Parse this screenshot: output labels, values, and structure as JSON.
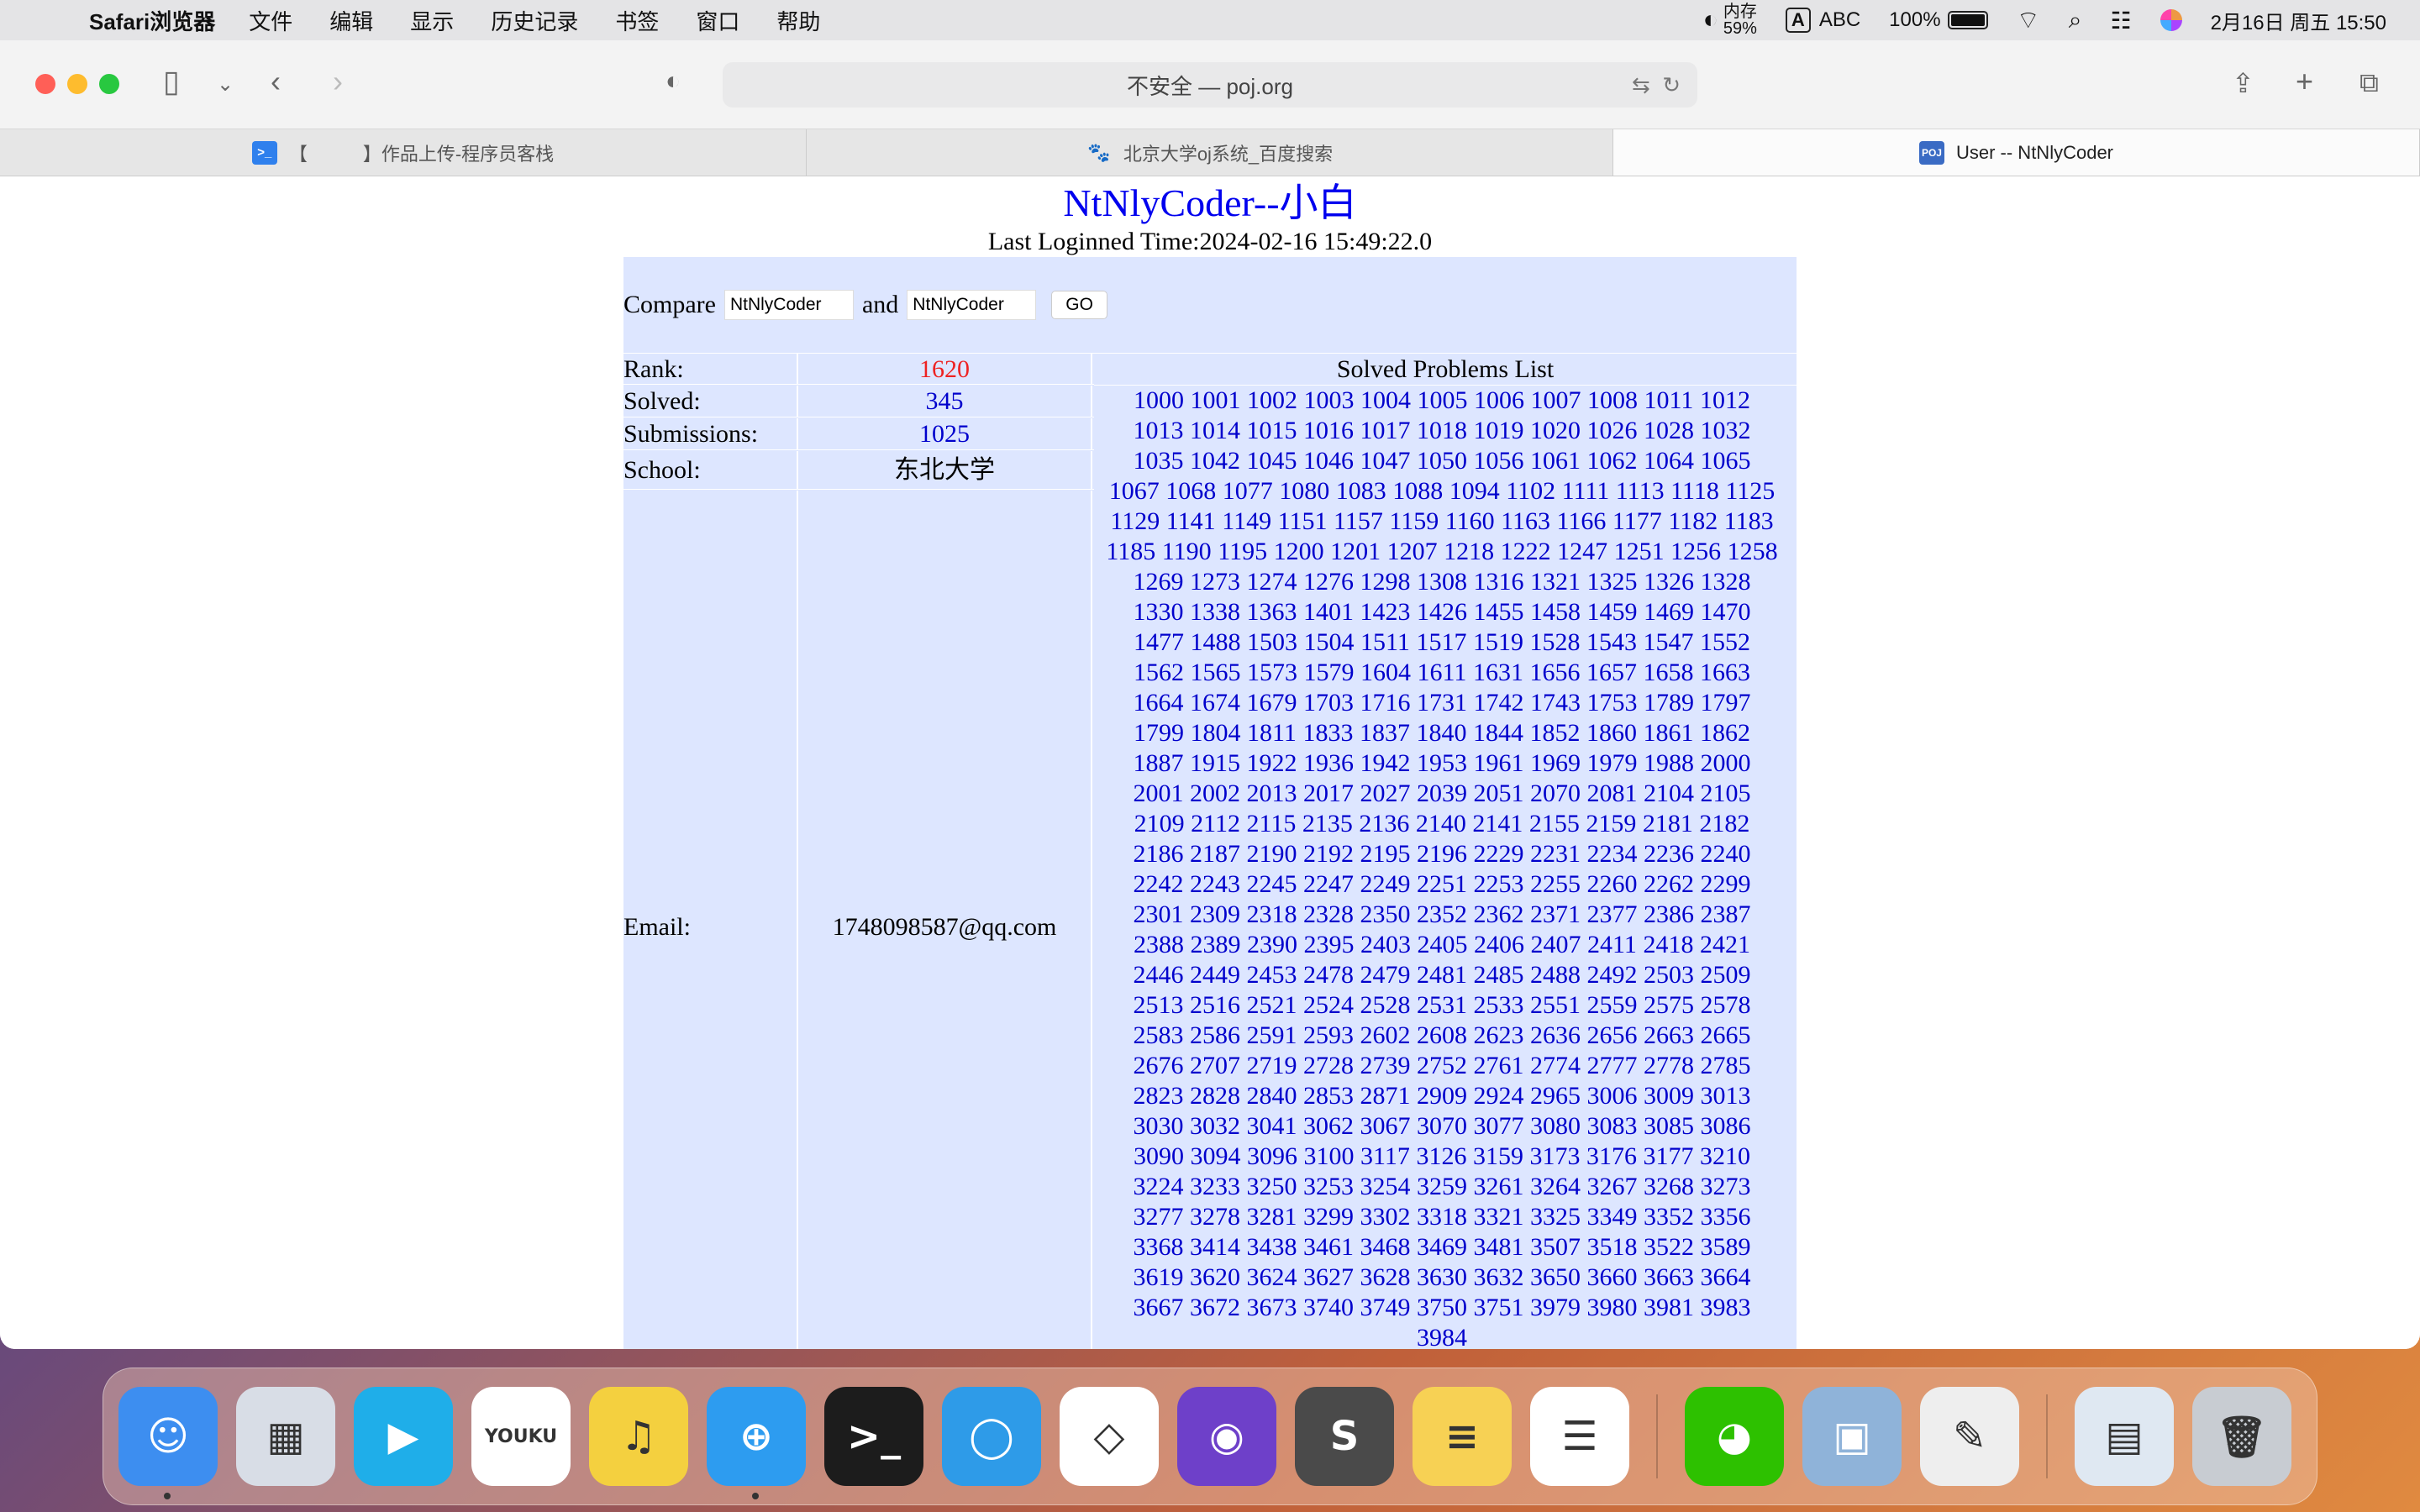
{
  "menubar": {
    "app_name": "Safari浏览器",
    "items": [
      "文件",
      "编辑",
      "显示",
      "历史记录",
      "书签",
      "窗口",
      "帮助"
    ],
    "status": {
      "vpn_label": "内存",
      "vpn_value": "59%",
      "input_badge": "A",
      "input_method": "ABC",
      "battery": "100%",
      "battery_level": 1.0,
      "datetime": "2月16日 周五  15:50"
    }
  },
  "browser": {
    "address": "不安全 — poj.org",
    "tabs": [
      {
        "title": "【　　　】作品上传-程序员客栈",
        "favicon_label": ">_",
        "favicon_color": "#2f80ed",
        "active": false
      },
      {
        "title": "北京大学oj系统_百度搜索",
        "favicon_label": "🐾",
        "favicon_color": "#2932e1",
        "active": false
      },
      {
        "title": "User -- NtNlyCoder",
        "favicon_label": "POJ",
        "favicon_color": "#3a6bc4",
        "active": true
      }
    ]
  },
  "page": {
    "title": "NtNlyCoder--小白",
    "last_login": "Last Loginned Time:2024-02-16 15:49:22.0",
    "compare": {
      "label": "Compare",
      "and_label": "and",
      "user1": "NtNlyCoder",
      "user2": "NtNlyCoder",
      "go_label": "GO"
    },
    "stats": {
      "rank_label": "Rank:",
      "rank_value": "1620",
      "solved_label": "Solved:",
      "solved_value": "345",
      "submissions_label": "Submissions:",
      "submissions_value": "1025",
      "school_label": "School:",
      "school_value": "东北大学",
      "email_label": "Email:",
      "email_value": "1748098587@qq.com"
    },
    "solved_header": "Solved Problems List",
    "solved_problems": [
      "1000",
      "1001",
      "1002",
      "1003",
      "1004",
      "1005",
      "1006",
      "1007",
      "1008",
      "1011",
      "1012",
      "1013",
      "1014",
      "1015",
      "1016",
      "1017",
      "1018",
      "1019",
      "1020",
      "1026",
      "1028",
      "1032",
      "1035",
      "1042",
      "1045",
      "1046",
      "1047",
      "1050",
      "1056",
      "1061",
      "1062",
      "1064",
      "1065",
      "1067",
      "1068",
      "1077",
      "1080",
      "1083",
      "1088",
      "1094",
      "1102",
      "1111",
      "1113",
      "1118",
      "1125",
      "1129",
      "1141",
      "1149",
      "1151",
      "1157",
      "1159",
      "1160",
      "1163",
      "1166",
      "1177",
      "1182",
      "1183",
      "1185",
      "1190",
      "1195",
      "1200",
      "1201",
      "1207",
      "1218",
      "1222",
      "1247",
      "1251",
      "1256",
      "1258",
      "1269",
      "1273",
      "1274",
      "1276",
      "1298",
      "1308",
      "1316",
      "1321",
      "1325",
      "1326",
      "1328",
      "1330",
      "1338",
      "1363",
      "1401",
      "1423",
      "1426",
      "1455",
      "1458",
      "1459",
      "1469",
      "1470",
      "1477",
      "1488",
      "1503",
      "1504",
      "1511",
      "1517",
      "1519",
      "1528",
      "1543",
      "1547",
      "1552",
      "1562",
      "1565",
      "1573",
      "1579",
      "1604",
      "1611",
      "1631",
      "1656",
      "1657",
      "1658",
      "1663",
      "1664",
      "1674",
      "1679",
      "1703",
      "1716",
      "1731",
      "1742",
      "1743",
      "1753",
      "1789",
      "1797",
      "1799",
      "1804",
      "1811",
      "1833",
      "1837",
      "1840",
      "1844",
      "1852",
      "1860",
      "1861",
      "1862",
      "1887",
      "1915",
      "1922",
      "1936",
      "1942",
      "1953",
      "1961",
      "1969",
      "1979",
      "1988",
      "2000",
      "2001",
      "2002",
      "2013",
      "2017",
      "2027",
      "2039",
      "2051",
      "2070",
      "2081",
      "2104",
      "2105",
      "2109",
      "2112",
      "2115",
      "2135",
      "2136",
      "2140",
      "2141",
      "2155",
      "2159",
      "2181",
      "2182",
      "2186",
      "2187",
      "2190",
      "2192",
      "2195",
      "2196",
      "2229",
      "2231",
      "2234",
      "2236",
      "2240",
      "2242",
      "2243",
      "2245",
      "2247",
      "2249",
      "2251",
      "2253",
      "2255",
      "2260",
      "2262",
      "2299",
      "2301",
      "2309",
      "2318",
      "2328",
      "2350",
      "2352",
      "2362",
      "2371",
      "2377",
      "2386",
      "2387",
      "2388",
      "2389",
      "2390",
      "2395",
      "2403",
      "2405",
      "2406",
      "2407",
      "2411",
      "2418",
      "2421",
      "2446",
      "2449",
      "2453",
      "2478",
      "2479",
      "2481",
      "2485",
      "2488",
      "2492",
      "2503",
      "2509",
      "2513",
      "2516",
      "2521",
      "2524",
      "2528",
      "2531",
      "2533",
      "2551",
      "2559",
      "2575",
      "2578",
      "2583",
      "2586",
      "2591",
      "2593",
      "2602",
      "2608",
      "2623",
      "2636",
      "2656",
      "2663",
      "2665",
      "2676",
      "2707",
      "2719",
      "2728",
      "2739",
      "2752",
      "2761",
      "2774",
      "2777",
      "2778",
      "2785",
      "2823",
      "2828",
      "2840",
      "2853",
      "2871",
      "2909",
      "2924",
      "2965",
      "3006",
      "3009",
      "3013",
      "3030",
      "3032",
      "3041",
      "3062",
      "3067",
      "3070",
      "3077",
      "3080",
      "3083",
      "3085",
      "3086",
      "3090",
      "3094",
      "3096",
      "3100",
      "3117",
      "3126",
      "3159",
      "3173",
      "3176",
      "3177",
      "3210",
      "3224",
      "3233",
      "3250",
      "3253",
      "3254",
      "3259",
      "3261",
      "3264",
      "3267",
      "3268",
      "3273",
      "3277",
      "3278",
      "3281",
      "3299",
      "3302",
      "3318",
      "3321",
      "3325",
      "3349",
      "3352",
      "3356",
      "3368",
      "3414",
      "3438",
      "3461",
      "3468",
      "3469",
      "3481",
      "3507",
      "3518",
      "3522",
      "3589",
      "3619",
      "3620",
      "3624",
      "3627",
      "3628",
      "3630",
      "3632",
      "3650",
      "3660",
      "3663",
      "3664",
      "3667",
      "3672",
      "3673",
      "3740",
      "3749",
      "3750",
      "3751",
      "3979",
      "3980",
      "3981",
      "3983",
      "3984"
    ]
  },
  "dock": {
    "apps": [
      {
        "name": "finder-icon",
        "label": "☺",
        "color": "#3d8ef0",
        "running": true
      },
      {
        "name": "launchpad-icon",
        "label": "▦",
        "color": "#d8dde6",
        "running": false
      },
      {
        "name": "tencent-video-icon",
        "label": "▶",
        "color": "#1faee9",
        "running": false
      },
      {
        "name": "youku-icon",
        "label": "YOUKU",
        "color": "#ffffff",
        "running": false
      },
      {
        "name": "qq-music-icon",
        "label": "♫",
        "color": "#f4d03f",
        "running": false
      },
      {
        "name": "safari-icon",
        "label": "⊕",
        "color": "#2d9cf0",
        "running": true
      },
      {
        "name": "terminal-icon",
        "label": ">_",
        "color": "#1c1c1c",
        "running": false
      },
      {
        "name": "chat-app-icon",
        "label": "◯",
        "color": "#2e9be8",
        "running": false
      },
      {
        "name": "unity-icon",
        "label": "◇",
        "color": "#ffffff",
        "running": false
      },
      {
        "name": "github-desktop-icon",
        "label": "◉",
        "color": "#6e40c9",
        "running": false
      },
      {
        "name": "sublime-text-icon",
        "label": "S",
        "color": "#4a4a4a",
        "running": false
      },
      {
        "name": "notes-icon",
        "label": "≡",
        "color": "#f7d154",
        "running": false
      },
      {
        "name": "reminders-icon",
        "label": "☰",
        "color": "#ffffff",
        "running": false
      },
      {
        "name": "wechat-icon",
        "label": "◕",
        "color": "#2dc100",
        "running": false
      },
      {
        "name": "preview-icon",
        "label": "▣",
        "color": "#8fb3d9",
        "running": false
      },
      {
        "name": "textedit-icon",
        "label": "✎",
        "color": "#eeeeee",
        "running": false
      },
      {
        "name": "downloads-stack-icon",
        "label": "▤",
        "color": "#dfe8f2",
        "running": false
      },
      {
        "name": "trash-icon",
        "label": "🗑",
        "color": "#c8ccd2",
        "running": false
      }
    ]
  },
  "colors": {
    "rank": "#ee2222",
    "link": "#0000cc",
    "panel_bg": "#dde6ff"
  }
}
